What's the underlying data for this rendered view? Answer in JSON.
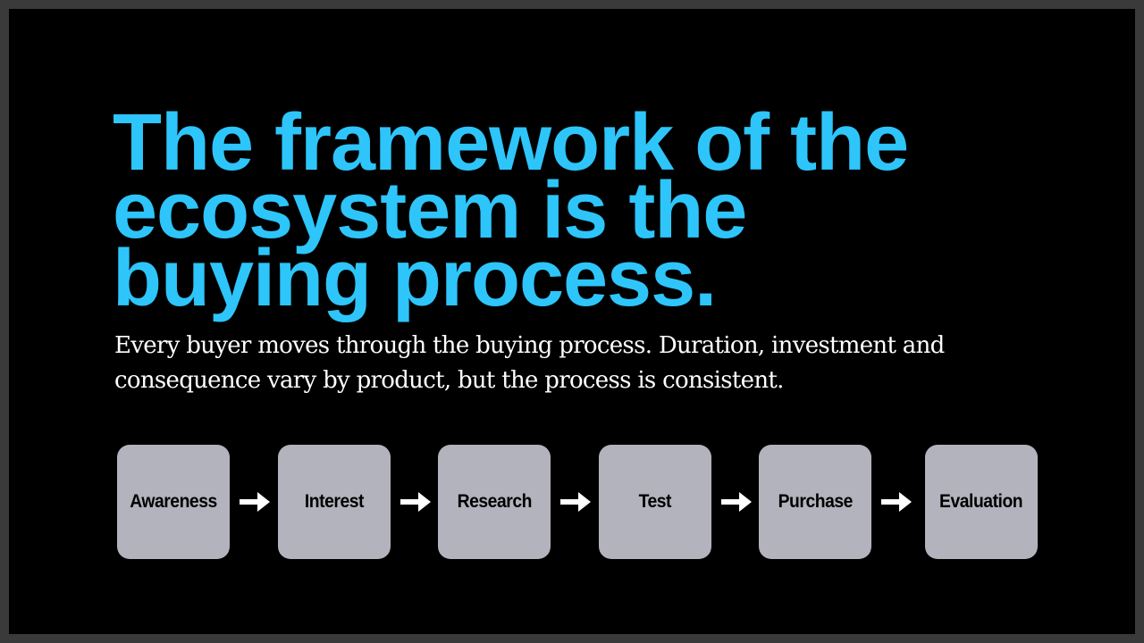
{
  "slide": {
    "title_lines": [
      "The framework of the",
      "ecosystem is the",
      "buying process."
    ],
    "subtitle": "Every buyer moves through the buying process. Duration, investment and consequence vary by product, but the process is consistent."
  },
  "process": {
    "steps": [
      {
        "label": "Awareness"
      },
      {
        "label": "Interest"
      },
      {
        "label": "Research"
      },
      {
        "label": "Test"
      },
      {
        "label": "Purchase"
      },
      {
        "label": "Evaluation"
      }
    ]
  },
  "colors": {
    "title": "#2ec5fa",
    "background": "#000000",
    "step_fill": "#b3b3bd",
    "arrow": "#ffffff",
    "frame": "#3a3a3a"
  },
  "icons": {
    "connector": "arrow-right-icon"
  }
}
